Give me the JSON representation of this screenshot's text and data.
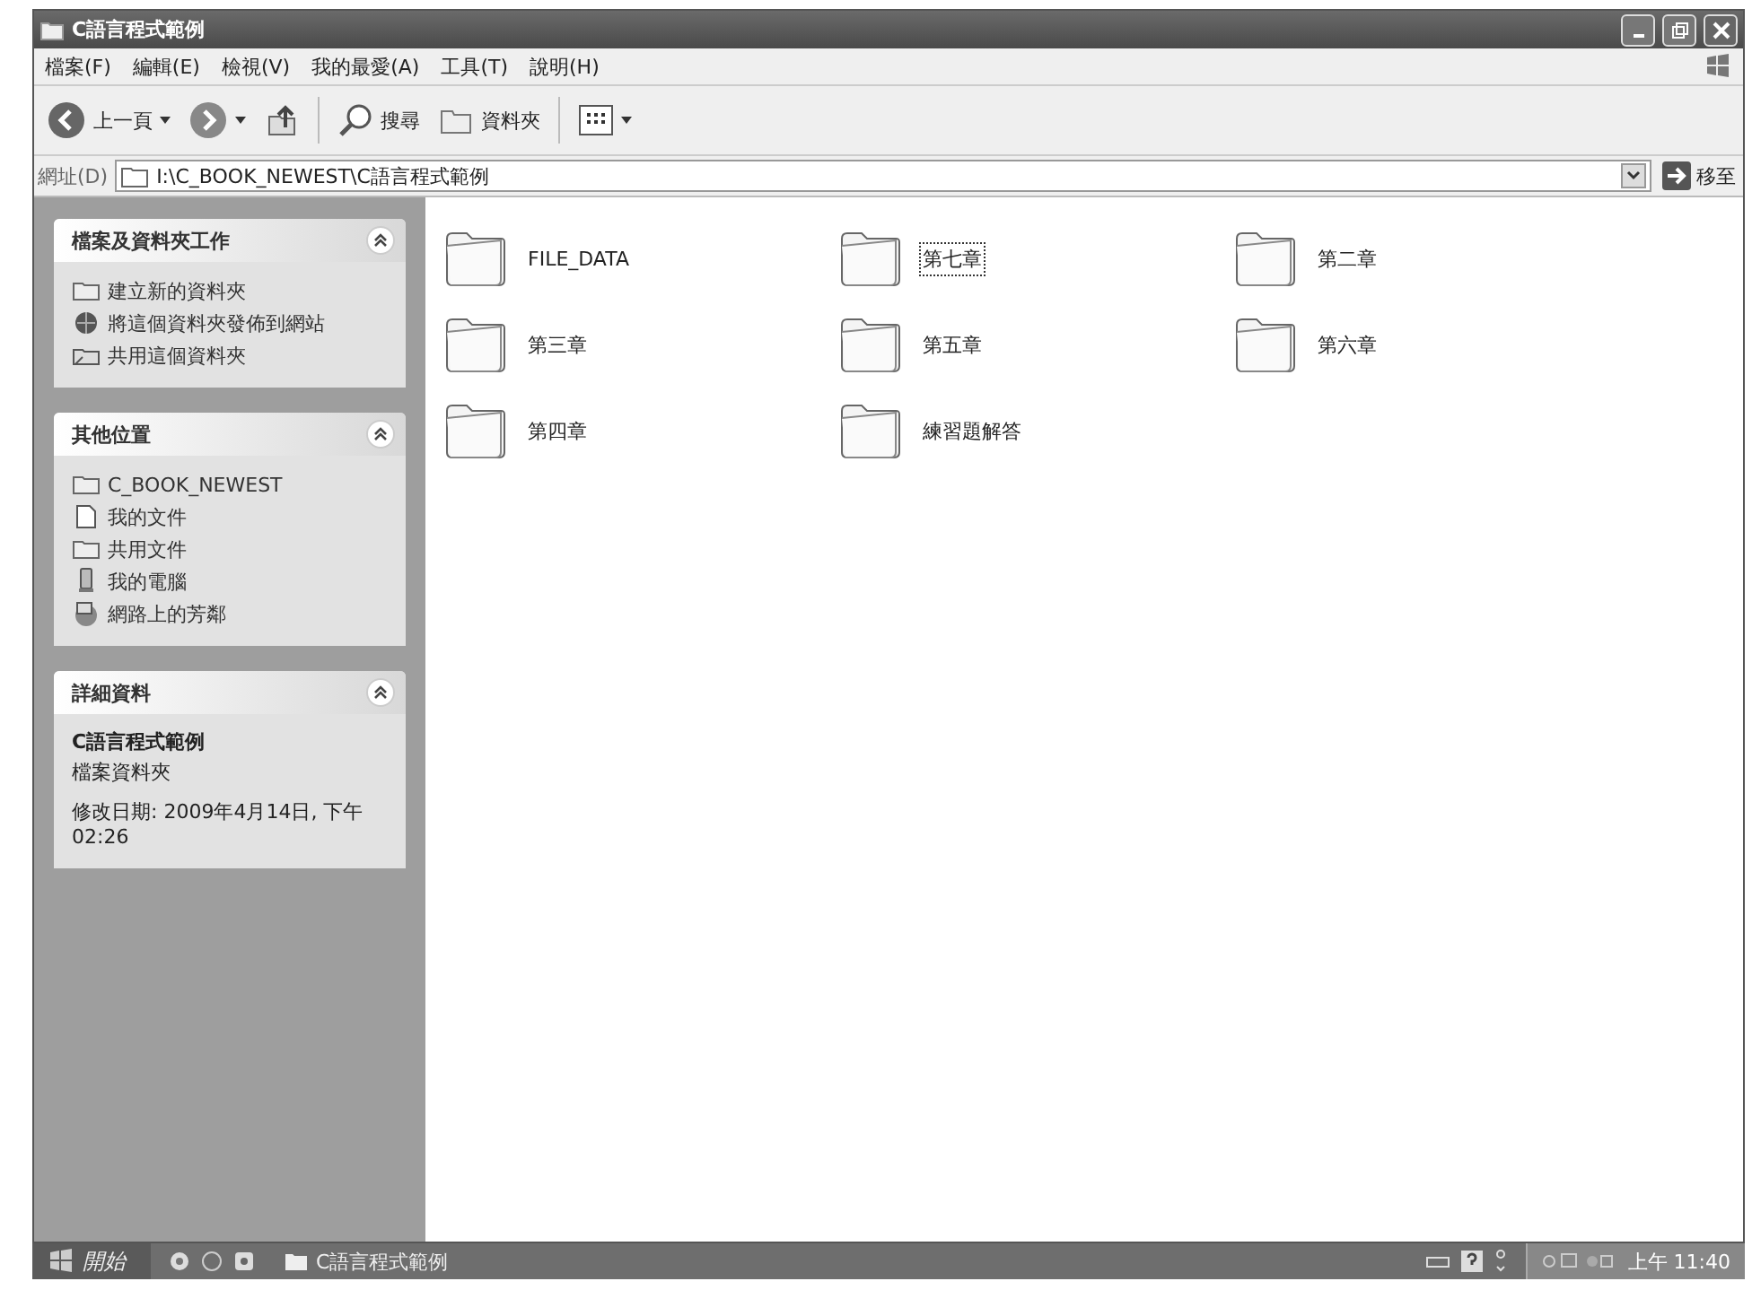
{
  "window": {
    "title": "C語言程式範例"
  },
  "menu": [
    "檔案(F)",
    "編輯(E)",
    "檢視(V)",
    "我的最愛(A)",
    "工具(T)",
    "說明(H)"
  ],
  "toolbar": {
    "back": "上一頁",
    "search": "搜尋",
    "folders": "資料夾"
  },
  "address": {
    "label": "網址(D)",
    "value": "I:\\C_BOOK_NEWEST\\C語言程式範例",
    "go": "移至"
  },
  "sidebar": [
    {
      "title": "檔案及資料夾工作",
      "expanded": true,
      "kind": "links",
      "items": [
        {
          "label": "建立新的資料夾"
        },
        {
          "label": "將這個資料夾發佈到網站"
        },
        {
          "label": "共用這個資料夾"
        }
      ]
    },
    {
      "title": "其他位置",
      "expanded": true,
      "kind": "links",
      "items": [
        {
          "label": "C_BOOK_NEWEST"
        },
        {
          "label": "我的文件"
        },
        {
          "label": "共用文件"
        },
        {
          "label": "我的電腦"
        },
        {
          "label": "網路上的芳鄰"
        }
      ]
    },
    {
      "title": "詳細資料",
      "expanded": true,
      "kind": "details",
      "name": "C語言程式範例",
      "type": "檔案資料夾",
      "modified": "修改日期: 2009年4月14日, 下午 02:26"
    }
  ],
  "folders": [
    {
      "name": "FILE_DATA",
      "focused": false
    },
    {
      "name": "第七章",
      "focused": true
    },
    {
      "name": "第二章",
      "focused": false
    },
    {
      "name": "第三章",
      "focused": false
    },
    {
      "name": "第五章",
      "focused": false
    },
    {
      "name": "第六章",
      "focused": false
    },
    {
      "name": "第四章",
      "focused": false
    },
    {
      "name": "練習題解答",
      "focused": false
    }
  ],
  "taskbar": {
    "start": "開始",
    "task": "C語言程式範例",
    "clock": "上午 11:40"
  }
}
